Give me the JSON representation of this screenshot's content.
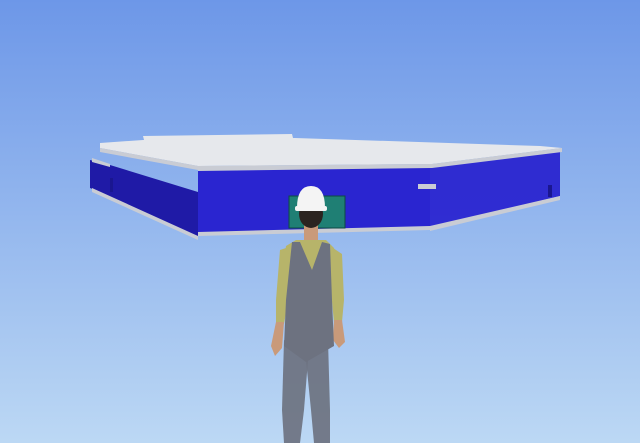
{
  "scene": {
    "sky_top_color": "#6d97e8",
    "sky_bottom_color": "#bcd8f4",
    "building": {
      "wall_color": "#2a25d0",
      "wall_shadow_color": "#1f1aa6",
      "roof_color": "#e6e8ec",
      "fascia_color": "#c9ccd4",
      "window_color": "#1f7f74"
    },
    "worker": {
      "helmet_color": "#f4f4f4",
      "shirt_color": "#b7b46a",
      "overalls_color": "#6d7280",
      "skin_color": "#c99a7a"
    }
  }
}
